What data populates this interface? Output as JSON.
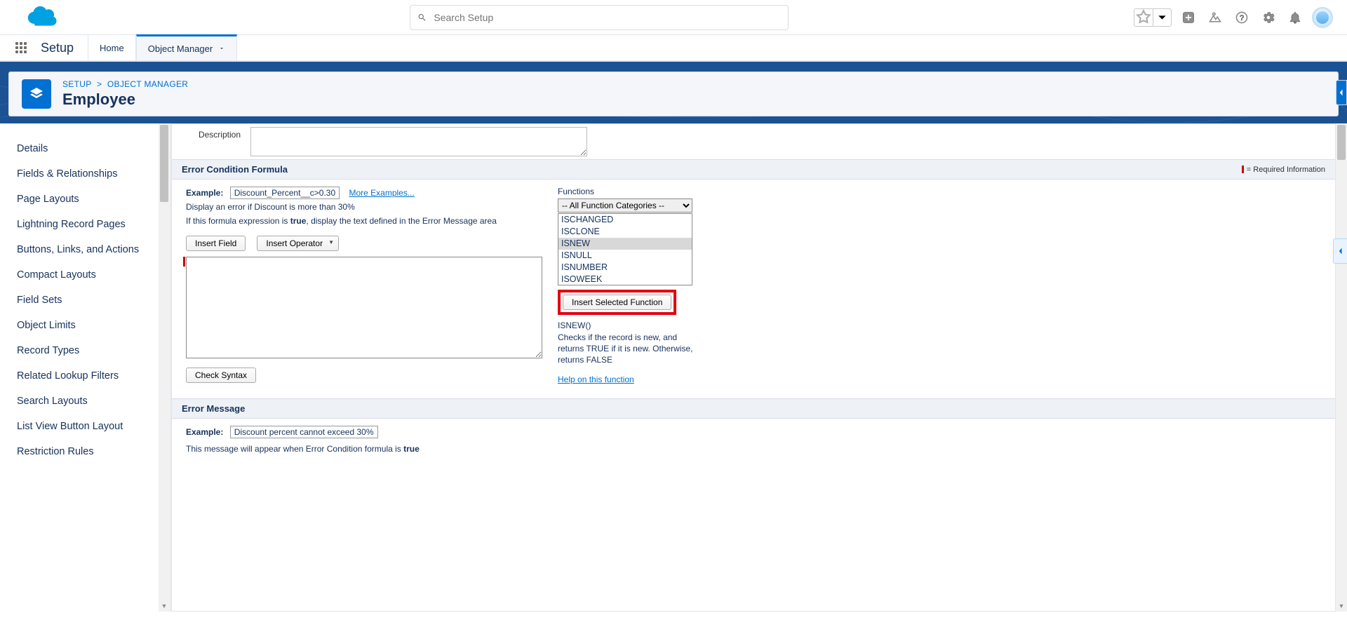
{
  "header": {
    "search_placeholder": "Search Setup"
  },
  "nav": {
    "setup_title": "Setup",
    "home": "Home",
    "object_manager": "Object Manager"
  },
  "banner": {
    "crumb_setup": "SETUP",
    "crumb_om": "OBJECT MANAGER",
    "title": "Employee"
  },
  "sidebar": {
    "items": [
      "Details",
      "Fields & Relationships",
      "Page Layouts",
      "Lightning Record Pages",
      "Buttons, Links, and Actions",
      "Compact Layouts",
      "Field Sets",
      "Object Limits",
      "Record Types",
      "Related Lookup Filters",
      "Search Layouts",
      "List View Button Layout",
      "Restriction Rules"
    ]
  },
  "form": {
    "description_label": "Description",
    "section_formula": "Error Condition Formula",
    "required_info": "= Required Information",
    "example_label": "Example:",
    "example_value": "Discount_Percent__c>0.30",
    "more_examples": "More Examples...",
    "example_desc": "Display an error if Discount is more than 30%",
    "if_prefix": "If this formula expression is ",
    "if_bold": "true",
    "if_suffix": ", display the text defined in the Error Message area",
    "insert_field": "Insert Field",
    "insert_operator": "Insert Operator",
    "check_syntax": "Check Syntax"
  },
  "functions": {
    "label": "Functions",
    "category": "-- All Function Categories --",
    "list": [
      "ISCHANGED",
      "ISCLONE",
      "ISNEW",
      "ISNULL",
      "ISNUMBER",
      "ISOWEEK"
    ],
    "selected_index": 2,
    "insert_button": "Insert Selected Function",
    "signature": "ISNEW()",
    "description": "Checks if the record is new, and returns TRUE if it is new. Otherwise, returns FALSE",
    "help": "Help on this function"
  },
  "error_msg": {
    "section": "Error Message",
    "example_label": "Example:",
    "example_value": "Discount percent cannot exceed 30%",
    "hint_prefix": "This message will appear when Error Condition formula is ",
    "hint_bold": "true"
  }
}
